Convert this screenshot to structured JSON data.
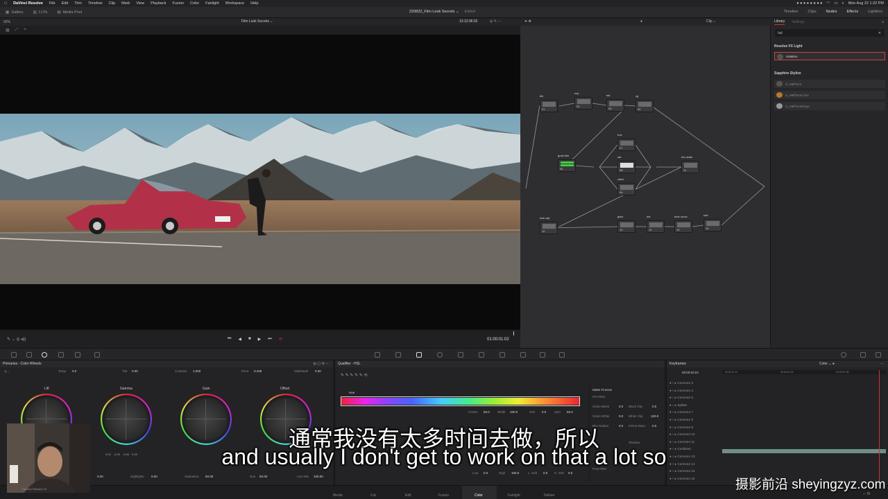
{
  "menubar": {
    "app": "DaVinci Resolve",
    "items": [
      "File",
      "Edit",
      "Trim",
      "Timeline",
      "Clip",
      "Mark",
      "View",
      "Playback",
      "Fusion",
      "Color",
      "Fairlight",
      "Workspace",
      "Help"
    ],
    "clock": "Mon Aug 22  1:22 PM"
  },
  "toolbar": {
    "left": [
      "Gallery",
      "LUTs",
      "Media Pool"
    ],
    "project": "220822_Film Look Secrets",
    "status": "Edited",
    "right": [
      "Timeline",
      "Clips",
      "Nodes",
      "Effects",
      "Lightbox"
    ]
  },
  "viewer": {
    "zoom": "92%",
    "clip_title": "Film Look Secrets",
    "timecode": "13:12:36:02",
    "playhead_tc": "01:00:01:02"
  },
  "nodes": {
    "mode": "Clip",
    "items": [
      {
        "label": "blk",
        "num": "01"
      },
      {
        "label": "exp",
        "num": "02"
      },
      {
        "label": "bal",
        "num": "03"
      },
      {
        "label": "cg",
        "num": "04"
      },
      {
        "label": "grain film",
        "num": "05"
      },
      {
        "label": "hue",
        "num": "07"
      },
      {
        "label": "sat",
        "num": "08"
      },
      {
        "label": "value",
        "num": "09"
      },
      {
        "label": "hsv adds",
        "num": "11"
      },
      {
        "label": "look adj",
        "num": "12"
      },
      {
        "label": "glow",
        "num": "13"
      },
      {
        "label": "hal",
        "num": "14"
      },
      {
        "label": "tone curve",
        "num": "15"
      },
      {
        "label": "soft",
        "num": "16"
      }
    ]
  },
  "library": {
    "tabs": [
      "Library",
      "Settings"
    ],
    "search": "hal",
    "sections": [
      {
        "title": "Resolve FX Light",
        "items": [
          "Halation"
        ]
      },
      {
        "title": "Sapphire Stylize",
        "items": [
          "S_HalfTone",
          "S_HalfToneColor",
          "S_HalfToneRings"
        ]
      }
    ]
  },
  "primaries": {
    "title": "Primaries - Color Wheels",
    "params": [
      {
        "k": "Temp",
        "v": "0.0"
      },
      {
        "k": "Tint",
        "v": "0.00"
      },
      {
        "k": "Contrast",
        "v": "1.000"
      },
      {
        "k": "Pivot",
        "v": "0.435"
      },
      {
        "k": "Mid/Detail",
        "v": "0.00"
      }
    ],
    "wheels": [
      {
        "name": "Lift"
      },
      {
        "name": "Gamma"
      },
      {
        "name": "Gain"
      },
      {
        "name": "Offset"
      }
    ],
    "wheel_vals": [
      "0.00",
      "-0.00",
      "-0.00",
      "0.00"
    ],
    "bottom": [
      {
        "k": "Highlights",
        "v": "0.00"
      },
      {
        "k": "Saturation",
        "v": "50.00"
      },
      {
        "k": "Hue",
        "v": "50.00"
      },
      {
        "k": "Lum Mix",
        "v": "100.00"
      }
    ],
    "first_value": "0.00"
  },
  "qualifier": {
    "title": "Qualifier - HSL",
    "hue_label": "Hue",
    "hue_vals": [
      {
        "k": "Center",
        "v": "50.0"
      },
      {
        "k": "Width",
        "v": "100.0"
      },
      {
        "k": "Soft",
        "v": "0.0"
      },
      {
        "k": "Sym",
        "v": "50.0"
      }
    ],
    "lum_vals": [
      {
        "k": "Low",
        "v": "0.0"
      },
      {
        "k": "High",
        "v": "100.0"
      },
      {
        "k": "L. Soft",
        "v": "0.0"
      },
      {
        "k": "H. Soft",
        "v": "0.0"
      }
    ],
    "matte": {
      "title": "Matte Finesse",
      "rows": [
        {
          "k": "Pre-Filter",
          "v": ""
        },
        {
          "k": "Clean Black",
          "v": "0.0"
        },
        {
          "k": "Black Clip",
          "v": "0.0"
        },
        {
          "k": "Clean White",
          "v": "0.0"
        },
        {
          "k": "White Clip",
          "v": "100.0"
        },
        {
          "k": "Blur Radius",
          "v": "0.0"
        },
        {
          "k": "In/Out Ratio",
          "v": "0.0"
        }
      ],
      "post": "Post-Filter",
      "shadow": "Shadow"
    }
  },
  "keyframes": {
    "title": "Keyframes",
    "mode": "Color",
    "timecode": "00:00:02:04",
    "ruler": [
      "00:00:01:11",
      "00:00:01:23",
      "00:00:01:35"
    ],
    "rows": [
      "Corrector 3",
      "Corrector 4",
      "Corrector 5",
      "Splitter",
      "Corrector 7",
      "Corrector 8",
      "Corrector 9",
      "Corrector 10",
      "Corrector 11",
      "Combiner",
      "Corrector 13",
      "Corrector 14",
      "Corrector 15",
      "Corrector 16"
    ]
  },
  "pages": [
    "Media",
    "Cut",
    "Edit",
    "Fusion",
    "Color",
    "Fairlight",
    "Deliver"
  ],
  "active_page": "Color",
  "webcam_label": "DaVinci Resolve 18",
  "subtitle_cn": "通常我没有太多时间去做，所以",
  "subtitle_en": "and usually I don't get to work on that a lot so",
  "watermark": "摄影前沿 sheyingzyz.com"
}
